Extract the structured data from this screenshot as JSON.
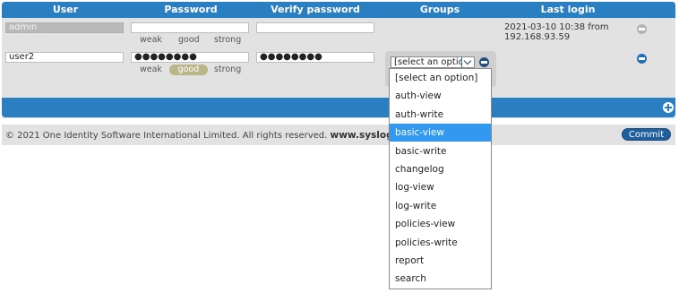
{
  "columns": [
    "User",
    "Password",
    "Verify password",
    "Groups",
    "Last login"
  ],
  "rows": [
    {
      "user": "admin",
      "password": "",
      "verify": "",
      "strength_labels": [
        "weak",
        "good",
        "strong"
      ],
      "last_login": [
        "2021-03-10 10:38 from",
        "192.168.93.59"
      ]
    },
    {
      "user": "user2",
      "password": "●●●●●●●●",
      "verify": "●●●●●●●●",
      "strength_labels": [
        "weak",
        "good",
        "strong"
      ],
      "strength_active": "good",
      "group_select": "[select an option]"
    }
  ],
  "group_options": [
    "[select an option]",
    "auth-view",
    "auth-write",
    "basic-view",
    "basic-write",
    "changelog",
    "log-view",
    "log-write",
    "policies-view",
    "policies-write",
    "report",
    "search"
  ],
  "selected_option": "basic-view",
  "footer": {
    "copyright": "© 2021 One Identity Software International Limited. All rights reserved.",
    "site": "www.syslog-ng.com",
    "commit_label": "Commit"
  },
  "colors": {
    "accent": "#2a7fc2",
    "selected": "#3399f0",
    "strength_good": "#bdb58a"
  }
}
